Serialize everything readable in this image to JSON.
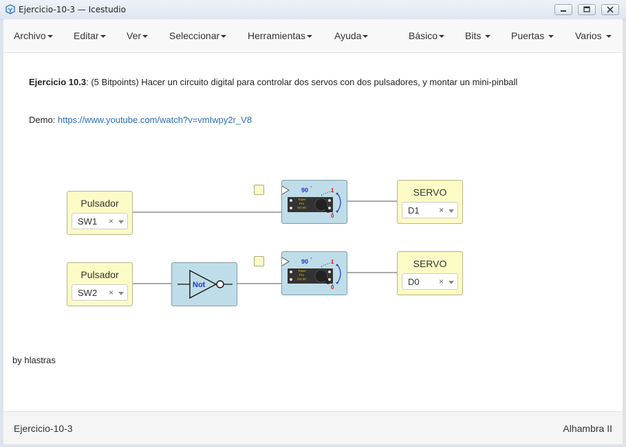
{
  "window": {
    "title": "Ejercicio-10-3 — Icestudio"
  },
  "menubar": {
    "left": [
      {
        "label": "Archivo"
      },
      {
        "label": "Editar"
      },
      {
        "label": "Ver"
      },
      {
        "label": "Seleccionar"
      },
      {
        "label": "Herramientas"
      },
      {
        "label": "Ayuda"
      }
    ],
    "right": [
      {
        "label": "Básico"
      },
      {
        "label": "Bits"
      },
      {
        "label": "Puertas"
      },
      {
        "label": "Varios"
      }
    ]
  },
  "description": {
    "bold": "Ejercicio 10.3",
    "text": ": (5 Bitpoints) Hacer un circuito digital para controlar dos servos con dos pulsadores, y montar un mini-pinball",
    "demo_label": "Demo: ",
    "demo_link": "https://www.youtube.com/watch?v=vmIwpy2r_V8",
    "byline": "by hlastras"
  },
  "blocks": {
    "input1": {
      "title": "Pulsador",
      "value": "SW1",
      "clear": "×"
    },
    "input2": {
      "title": "Pulsador",
      "value": "SW2",
      "clear": "×"
    },
    "output1": {
      "title": "SERVO",
      "value": "D1",
      "clear": "×"
    },
    "output2": {
      "title": "SERVO",
      "value": "D0",
      "clear": "×"
    },
    "not_gate": {
      "label": "Not"
    },
    "servo_module": {
      "angle": "90",
      "deg": "°",
      "max": "1",
      "min": "0",
      "brand_line1": "Tower",
      "brand_line2": "Pro",
      "brand_line3": "SG-90"
    }
  },
  "status": {
    "left": "Ejercicio-10-3",
    "right": "Alhambra II"
  }
}
